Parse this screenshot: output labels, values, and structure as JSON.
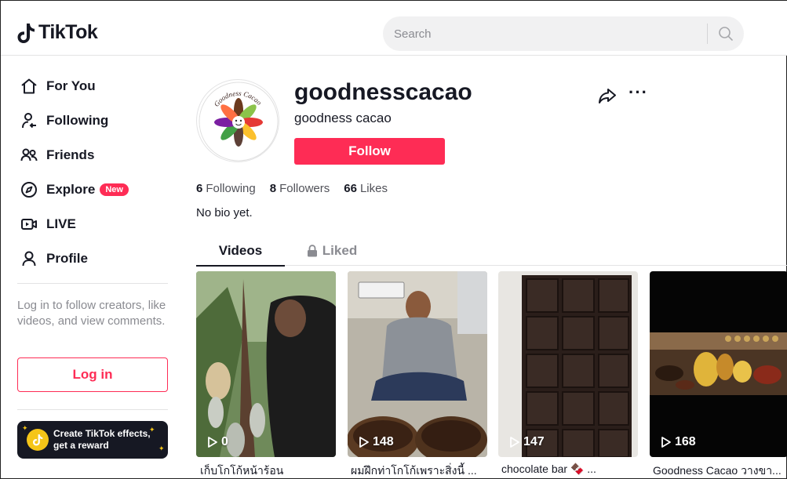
{
  "brand": {
    "name": "TikTok"
  },
  "search": {
    "placeholder": "Search"
  },
  "sidebar": {
    "nav": [
      {
        "label": "For You",
        "icon": "home-icon"
      },
      {
        "label": "Following",
        "icon": "following-icon"
      },
      {
        "label": "Friends",
        "icon": "friends-icon"
      },
      {
        "label": "Explore",
        "icon": "compass-icon",
        "badge": "New"
      },
      {
        "label": "LIVE",
        "icon": "live-icon"
      },
      {
        "label": "Profile",
        "icon": "profile-icon"
      }
    ],
    "login_hint": "Log in to follow creators, like videos, and view comments.",
    "login_label": "Log in",
    "effects": {
      "line1": "Create TikTok effects,",
      "line2": "get a reward"
    }
  },
  "profile": {
    "username": "goodnesscacao",
    "nickname": "goodness cacao",
    "follow_label": "Follow",
    "stats": [
      {
        "count": "6",
        "label": "Following"
      },
      {
        "count": "8",
        "label": "Followers"
      },
      {
        "count": "66",
        "label": "Likes"
      }
    ],
    "bio": "No bio yet.",
    "avatar_text": "Goodness Cacao"
  },
  "tabs": {
    "videos": "Videos",
    "liked": "Liked"
  },
  "videos": [
    {
      "views": "0",
      "caption": "เก็บโกโก้หน้าร้อน"
    },
    {
      "views": "148",
      "caption": "ผมฝึกท่าโกโก้เพราะสิ่งนี้ ..."
    },
    {
      "views": "147",
      "caption": "chocolate bar 🍫 ..."
    },
    {
      "views": "168",
      "caption": "Goodness Cacao วางขา..."
    }
  ],
  "colors": {
    "accent": "#fe2c55",
    "text": "#161823",
    "muted": "#8a8b91"
  }
}
